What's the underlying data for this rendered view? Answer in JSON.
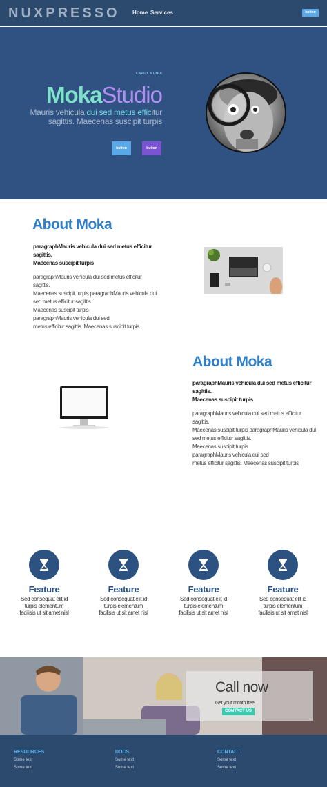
{
  "nav": {
    "brand": "NUXPRESSO",
    "links": [
      "Home",
      "Services"
    ],
    "button": "button"
  },
  "hero": {
    "eyebrow": "CAPUT MUNDI",
    "title_part1": "Moka",
    "title_part2": "Studio",
    "subtitle_a": "Mauris vehicula ",
    "subtitle_highlight": "dui sed metus effic",
    "subtitle_b": "itur",
    "subtitle_line2": "sagittis. Maecenas suscipit turpis",
    "button1": "button",
    "button2": "button"
  },
  "about1": {
    "title": "About Moka",
    "lead_line1": "paragraphMauris vehicula dui sed metus efficitur",
    "lead_line2": "sagittis.",
    "lead_line3": "Maecenas suscipit turpis",
    "body": [
      "paragraphMauris vehicula dui sed metus efficitur",
      "sagittis.",
      "Maecenas suscipit turpis paragraphMauris vehicula dui",
      "sed metus efficitur sagittis.",
      "Maecenas suscipit turpis",
      "paragraphMauris vehicula dui sed",
      "metus efficitur sagittis. Maecenas suscipit turpis"
    ]
  },
  "about2": {
    "title": "About Moka",
    "lead_line1": "paragraphMauris vehicula dui sed metus efficitur",
    "lead_line2": "sagittis.",
    "lead_line3": "Maecenas suscipit turpis",
    "body": [
      "paragraphMauris vehicula dui sed metus efficitur",
      "sagittis.",
      "Maecenas suscipit turpis paragraphMauris vehicula dui",
      "sed metus efficitur sagittis.",
      "Maecenas suscipit turpis",
      "paragraphMauris vehicula dui sed",
      "metus efficitur sagittis. Maecenas suscipit turpis"
    ]
  },
  "features": [
    {
      "icon": "hourglass-icon",
      "title": "Feature",
      "line1": "Sed consequat elit id",
      "line2": "turpis elementum",
      "line3": "facilisis ut sit amet nisl"
    },
    {
      "icon": "hourglass-icon",
      "title": "Feature",
      "line1": "Sed consequat elit id",
      "line2": "turpis elementum",
      "line3": "facilisis ut sit amet nisl"
    },
    {
      "icon": "hourglass-icon",
      "title": "Feature",
      "line1": "Sed consequat elit id",
      "line2": "turpis elementum",
      "line3": "facilisis ut sit amet nisl"
    },
    {
      "icon": "hourglass-icon",
      "title": "Feature",
      "line1": "Sed consequat elit id",
      "line2": "turpis elementum",
      "line3": "facilisis ut sit amet nisl"
    }
  ],
  "callnow": {
    "title": "Call now",
    "subtitle": "Get your month free!",
    "button": "CONTACT US"
  },
  "footer": {
    "columns": [
      {
        "heading": "RESOURCES",
        "items": [
          "Some text",
          "Some text"
        ]
      },
      {
        "heading": "DOCS",
        "items": [
          "Some text",
          "Some text"
        ]
      },
      {
        "heading": "CONTACT",
        "items": [
          "Some text",
          "Some text"
        ]
      }
    ]
  },
  "colors": {
    "nav_bg": "#2c4a6e",
    "hero_bg": "#2f5283",
    "accent_blue": "#2f7fc9",
    "accent_teal": "#7fe3cc",
    "accent_purple": "#b18ef0",
    "contact_button": "#3bc9b0"
  }
}
